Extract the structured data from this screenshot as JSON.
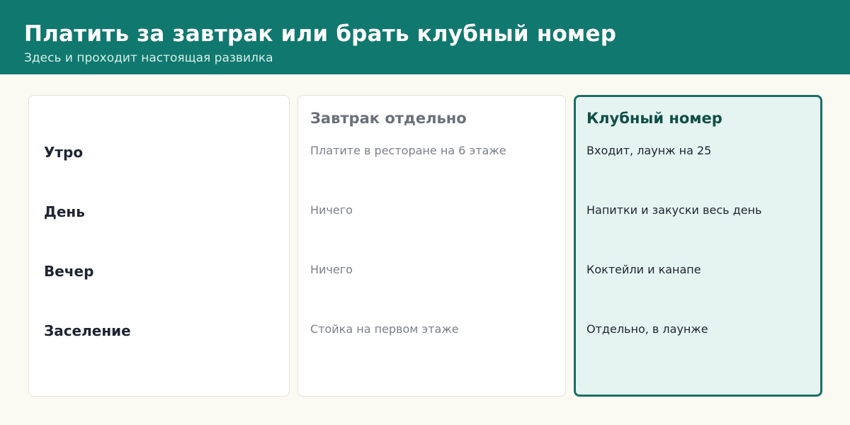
{
  "header": {
    "title": "Платить за завтрак или брать клубный номер",
    "subtitle": "Здесь и проходит настоящая развилка"
  },
  "rows": [
    "Утро",
    "День",
    "Вечер",
    "Заселение"
  ],
  "columns": [
    {
      "heading": "Завтрак отдельно",
      "cells": [
        "Платите в ресторане на 6 этаже",
        "Ничего",
        "Ничего",
        "Стойка на первом этаже"
      ]
    },
    {
      "heading": "Клубный номер",
      "highlighted": true,
      "cells": [
        "Входит, лаунж на 25",
        "Напитки и закуски весь день",
        "Коктейли и канапе",
        "Отдельно, в лаунже"
      ]
    }
  ],
  "colors": {
    "header_bg": "#10786f",
    "page_bg": "#fafaf3",
    "highlight_bg": "#e6f4f1",
    "highlight_border": "#1b6f66"
  }
}
